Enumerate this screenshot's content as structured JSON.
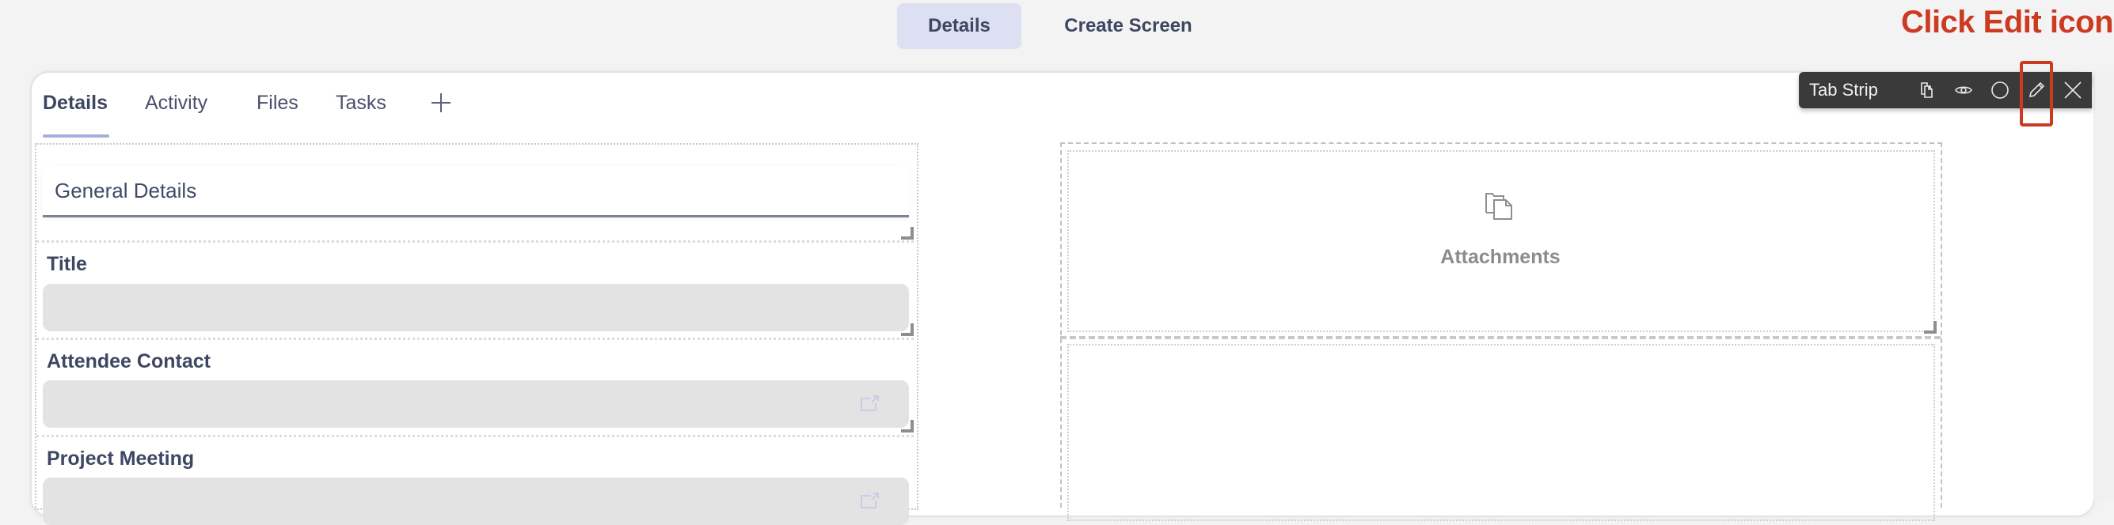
{
  "top_tabs": [
    {
      "label": "Details",
      "active": true
    },
    {
      "label": "Create Screen",
      "active": false
    }
  ],
  "annotation": {
    "text": "Click Edit icon",
    "color": "#cc3a22"
  },
  "card": {
    "tabs": [
      {
        "label": "Details",
        "active": true
      },
      {
        "label": "Activity",
        "active": false
      },
      {
        "label": "Files",
        "active": false
      },
      {
        "label": "Tasks",
        "active": false
      }
    ],
    "add_tab_icon": "plus-icon",
    "accent": "#a7b0db"
  },
  "toolbar": {
    "title": "Tab Strip",
    "icons": [
      "copy-icon",
      "eye-icon",
      "circle-icon",
      "pencil-icon",
      "close-icon"
    ]
  },
  "left_panel": {
    "section_title": "General Details",
    "fields": [
      {
        "label": "Title",
        "value": "",
        "icon": null
      },
      {
        "label": "Attendee Contact",
        "value": "",
        "icon": "external-link-icon"
      },
      {
        "label": "Project Meeting",
        "value": "",
        "icon": "external-link-icon"
      }
    ]
  },
  "right_panel": {
    "attachments_label": "Attachments",
    "attachments_icon": "attachments-icon"
  }
}
